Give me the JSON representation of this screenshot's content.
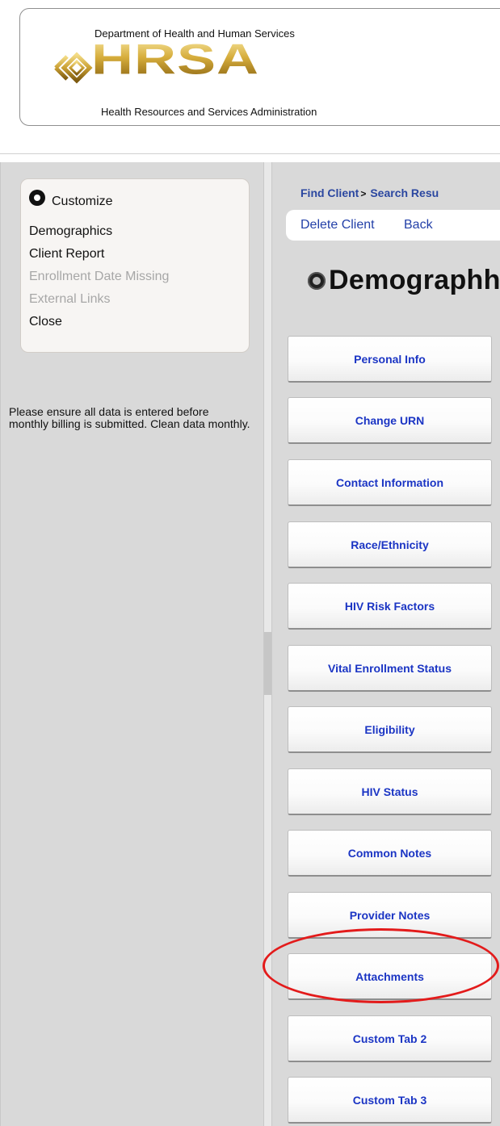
{
  "header": {
    "department": "Department of Health and Human Services",
    "logo_text": "HRSA",
    "subtitle": "Health Resources and Services Administration"
  },
  "sidebar": {
    "customize_label": "Customize",
    "items": [
      {
        "label": "Demographics",
        "enabled": true
      },
      {
        "label": "Client Report",
        "enabled": true
      },
      {
        "label": "Enrollment Date Missing",
        "enabled": false
      },
      {
        "label": "External Links",
        "enabled": false
      },
      {
        "label": "Close",
        "enabled": true
      }
    ],
    "note": "Please ensure all data is entered before monthly billing is submitted. Clean data monthly."
  },
  "breadcrumb": {
    "items": [
      "Find Client",
      "Search Resu"
    ],
    "separator": ">"
  },
  "actions": {
    "delete_client": "Delete Client",
    "back": "Back"
  },
  "page": {
    "title": "Demographh"
  },
  "sections": [
    {
      "label": "Personal Info"
    },
    {
      "label": "Change URN"
    },
    {
      "label": "Contact Information"
    },
    {
      "label": "Race/Ethnicity"
    },
    {
      "label": "HIV Risk Factors"
    },
    {
      "label": "Vital Enrollment Status"
    },
    {
      "label": "Eligibility"
    },
    {
      "label": "HIV Status"
    },
    {
      "label": "Common Notes"
    },
    {
      "label": "Provider Notes"
    },
    {
      "label": "Attachments",
      "highlighted": true
    },
    {
      "label": "Custom Tab 2"
    },
    {
      "label": "Custom Tab 3"
    }
  ],
  "colors": {
    "link_blue": "#1b35c4",
    "highlight_red": "#e31b1b",
    "panel_gray": "#d9d9d9"
  }
}
